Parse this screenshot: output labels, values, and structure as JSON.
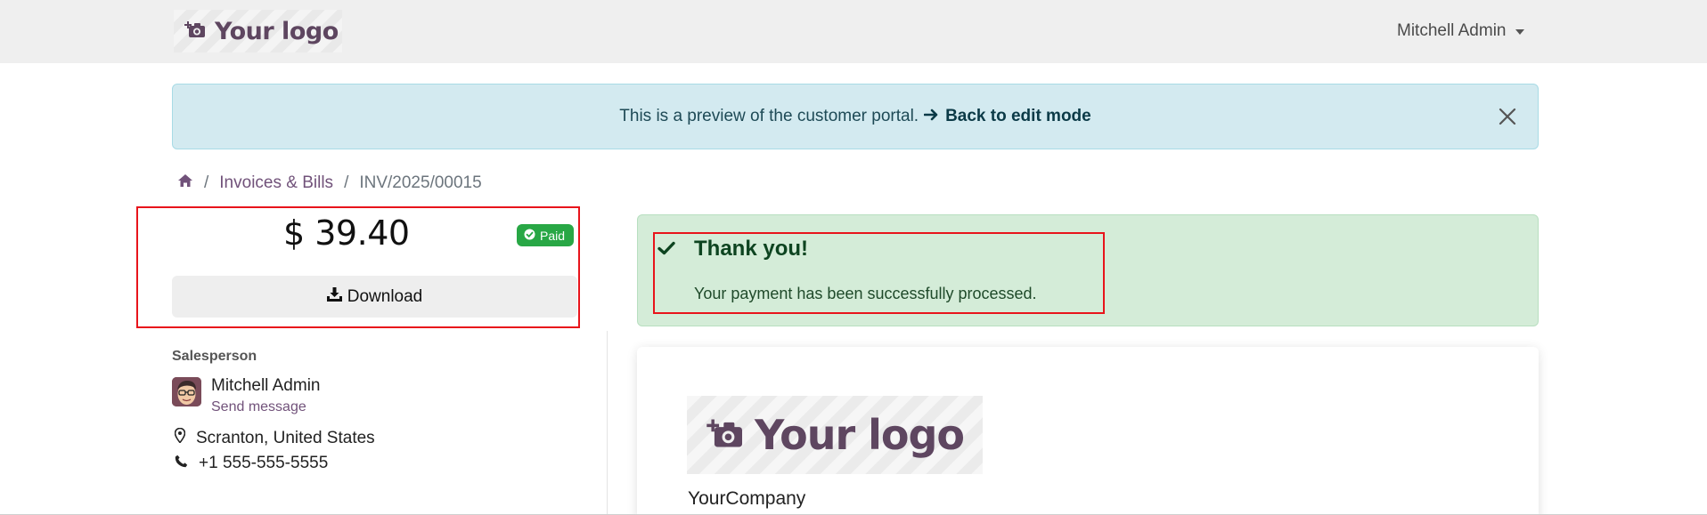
{
  "header": {
    "logo_text": "Your logo",
    "user_name": "Mitchell Admin"
  },
  "banner": {
    "text": "This is a preview of the customer portal.",
    "link_label": "Back to edit mode"
  },
  "breadcrumb": {
    "items": [
      "Invoices & Bills",
      "INV/2025/00015"
    ]
  },
  "invoice": {
    "amount": "$ 39.40",
    "status": "Paid",
    "download_label": "Download"
  },
  "salesperson": {
    "section_title": "Salesperson",
    "name": "Mitchell Admin",
    "send_message": "Send message",
    "location": "Scranton, United States",
    "phone": "+1 555-555-5555"
  },
  "alert": {
    "title": "Thank you!",
    "message": "Your payment has been successfully processed."
  },
  "document": {
    "logo_text": "Your logo",
    "company_name": "YourCompany"
  },
  "colors": {
    "brand": "#71527a",
    "success": "#28a745",
    "highlight": "#e8141b"
  },
  "icons": {
    "logo": "camera-plus-icon",
    "home": "home-icon",
    "check": "check-icon",
    "download": "download-icon",
    "location": "map-marker-icon",
    "phone": "phone-icon",
    "close": "close-icon"
  }
}
